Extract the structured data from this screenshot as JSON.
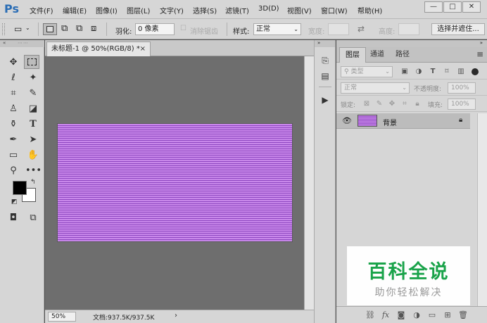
{
  "app": {
    "logo": "Ps"
  },
  "menu": {
    "items": [
      "文件(F)",
      "编辑(E)",
      "图像(I)",
      "图层(L)",
      "文字(Y)",
      "选择(S)",
      "滤镜(T)",
      "3D(D)",
      "视图(V)",
      "窗口(W)",
      "帮助(H)"
    ]
  },
  "window_controls": {
    "minimize": "—",
    "restore": "□",
    "close": "✕"
  },
  "options": {
    "marquee_icon": "▭",
    "feather_label": "羽化:",
    "feather_value": "0 像素",
    "antialias_label": "消除锯齿",
    "style_label": "样式:",
    "style_value": "正常",
    "width_label": "宽度:",
    "swap_icon": "⇄",
    "height_label": "高度:",
    "select_mask_button": "选择并遮住..."
  },
  "tools": {
    "fg_color": "#000000",
    "bg_color": "#ffffff"
  },
  "document": {
    "tab_title": "未标题-1 @ 50%(RGB/8) *",
    "tab_close": "×",
    "canvas_color_light": "#c887ea",
    "canvas_color_dark": "#8e48c0"
  },
  "status": {
    "zoom": "50%",
    "doc_info": "文档:937.5K/937.5K",
    "arrow": "›"
  },
  "layers_panel": {
    "tabs": [
      "图层",
      "通道",
      "路径"
    ],
    "filter_kind": "类型",
    "blend_mode": "正常",
    "opacity_label": "不透明度:",
    "opacity_value": "100%",
    "lock_label": "锁定:",
    "fill_label": "填充:",
    "fill_value": "100%",
    "layers": [
      {
        "name": "背景",
        "visible": true,
        "locked": true
      }
    ]
  },
  "watermark": {
    "title": "百科全说",
    "subtitle": "助你轻松解决"
  }
}
